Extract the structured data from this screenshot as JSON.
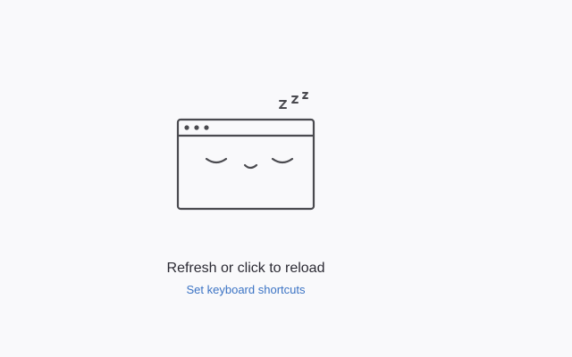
{
  "sleeping_tab": {
    "illustration": {
      "name": "sleeping-browser-window",
      "snore_text": "z z z",
      "stroke_color": "#4a4a4f"
    },
    "message": "Refresh or click to reload",
    "shortcuts_link": "Set keyboard shortcuts",
    "colors": {
      "background": "#f9f9fb",
      "text": "#2b2a33",
      "link": "#3b73c4"
    }
  }
}
